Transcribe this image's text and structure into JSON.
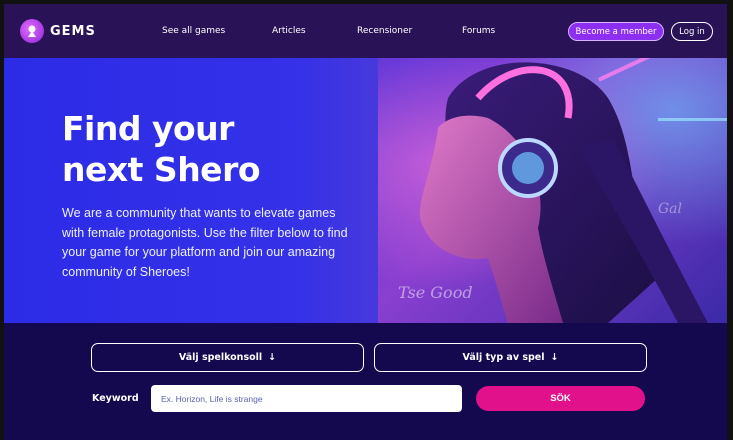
{
  "brand": {
    "name": "GEMS"
  },
  "nav": {
    "links": [
      {
        "label": "See all games"
      },
      {
        "label": "Articles"
      },
      {
        "label": "Recensioner"
      },
      {
        "label": "Forums"
      }
    ],
    "member_button": "Become a member",
    "login_button": "Log in"
  },
  "hero": {
    "title_line1": "Find your",
    "title_line2": "next Shero",
    "body": "We are a community that wants to elevate games with female protagonists. Use the filter below to find your game for your platform and join our amazing community of Sheroes!",
    "image_alt": "Woman with braids wearing glowing headphones"
  },
  "filters": {
    "console_select": "Välj spelkonsoll",
    "type_select": "Välj typ av spel",
    "keyword_label": "Keyword",
    "search_placeholder": "Ex. Horizon, Life is strange",
    "search_button": "SÖK"
  },
  "colors": {
    "header_bg": "#2a1257",
    "hero_bg": "#2c2be6",
    "page_bg": "#14094e",
    "accent_purple": "#8c2ff0",
    "accent_pink": "#e0118a"
  }
}
